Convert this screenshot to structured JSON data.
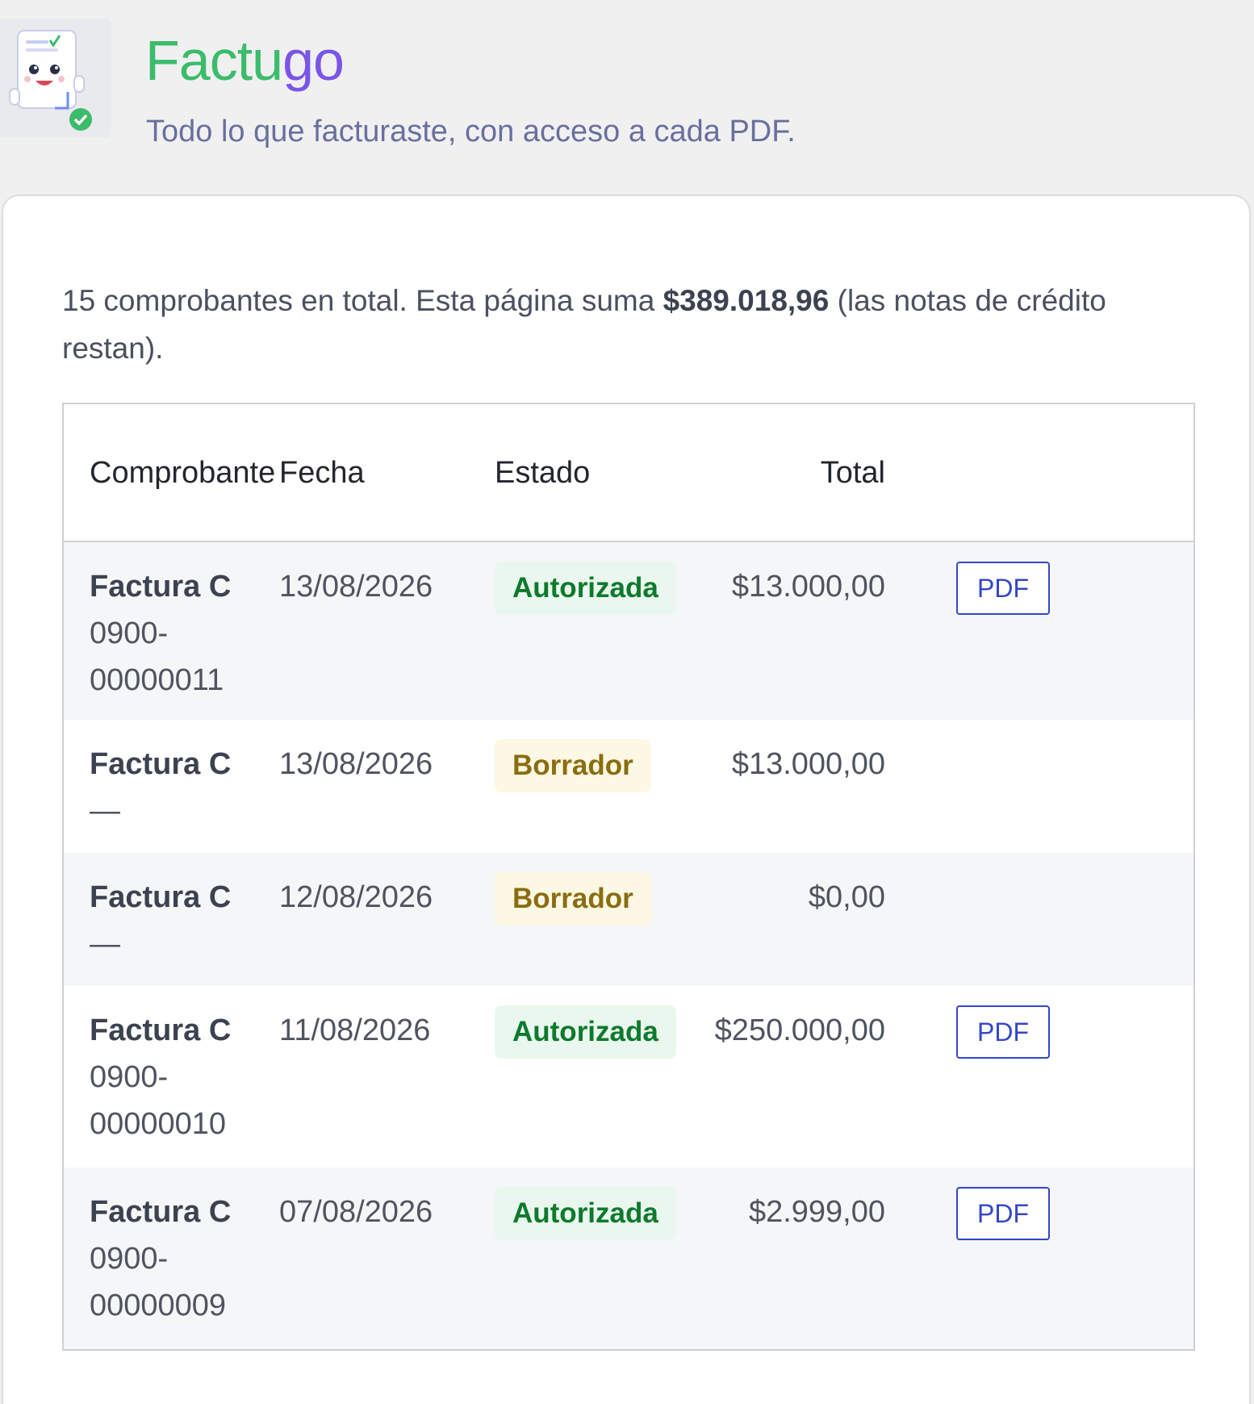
{
  "header": {
    "brand_part1": "Factu",
    "brand_part2": "go",
    "tagline": "Todo lo que facturaste, con acceso a cada PDF."
  },
  "summary": {
    "prefix": "15 comprobantes en total. Esta página suma ",
    "amount": "$389.018,96",
    "suffix": " (las notas de crédito restan)."
  },
  "table": {
    "columns": [
      "Comprobante",
      "Fecha",
      "Estado",
      "Total",
      ""
    ],
    "rows": [
      {
        "type": "Factura C",
        "number": "0900-00000011",
        "date": "13/08/2026",
        "status": "Autorizada",
        "status_kind": "ok",
        "total": "$13.000,00",
        "action": "PDF"
      },
      {
        "type": "Factura C",
        "number": "—",
        "date": "13/08/2026",
        "status": "Borrador",
        "status_kind": "draft",
        "total": "$13.000,00",
        "action": ""
      },
      {
        "type": "Factura C",
        "number": "—",
        "date": "12/08/2026",
        "status": "Borrador",
        "status_kind": "draft",
        "total": "$0,00",
        "action": ""
      },
      {
        "type": "Factura C",
        "number": "0900-00000010",
        "date": "11/08/2026",
        "status": "Autorizada",
        "status_kind": "ok",
        "total": "$250.000,00",
        "action": "PDF"
      },
      {
        "type": "Factura C",
        "number": "0900-00000009",
        "date": "07/08/2026",
        "status": "Autorizada",
        "status_kind": "ok",
        "total": "$2.999,00",
        "action": "PDF"
      }
    ]
  },
  "colors": {
    "brand_green": "#3cbc6b",
    "brand_purple": "#7b55e8",
    "status_ok": "#0c7a2c",
    "status_draft": "#8a6d10",
    "link_blue": "#3446c9"
  },
  "icons": {
    "logo": "invoice-mascot-icon"
  }
}
